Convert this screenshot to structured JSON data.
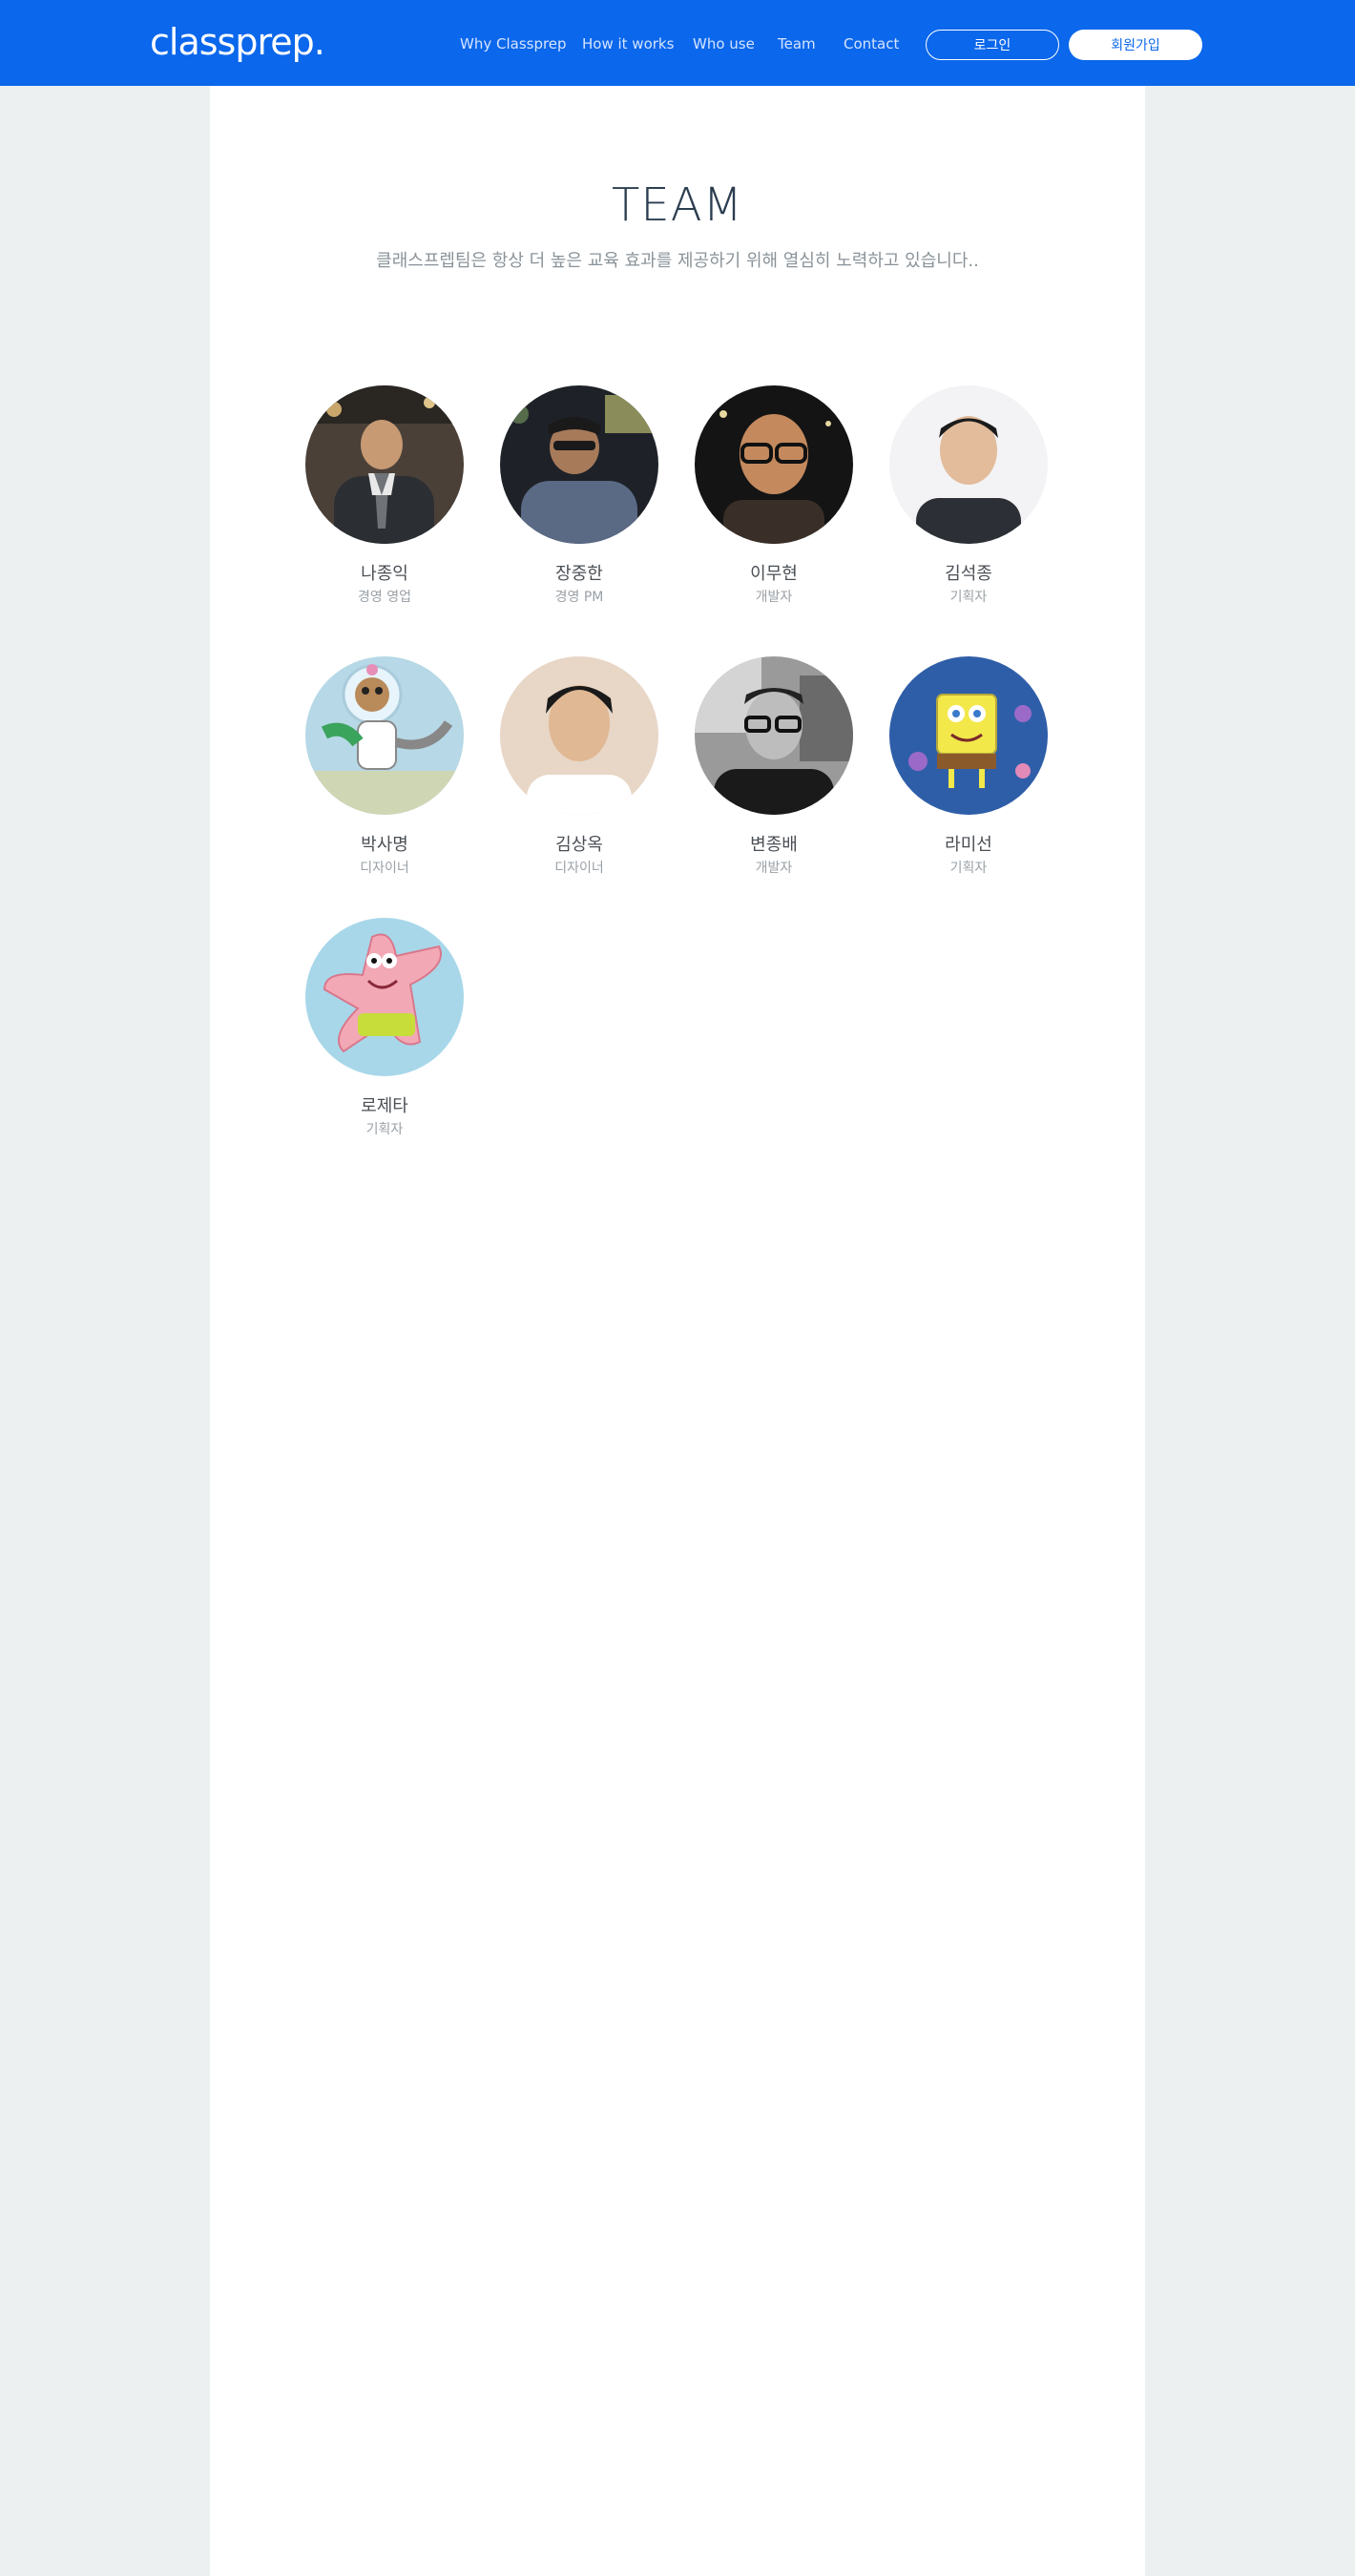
{
  "header": {
    "logo": "classprep.",
    "nav": [
      {
        "label": "Why Classprep"
      },
      {
        "label": "How it works"
      },
      {
        "label": "Who use"
      },
      {
        "label": "Team"
      },
      {
        "label": "Contact"
      }
    ],
    "login_label": "로그인",
    "signup_label": "회원가입",
    "brand_color": "#0b67eb"
  },
  "team": {
    "title": "TEAM",
    "subtitle": "클래스프렙팀은 항상 더 높은 교육 효과를 제공하기 위해 열심히 노력하고 있습니다..",
    "members": [
      {
        "name": "나종익",
        "role": "경영 영업",
        "avatar": "photo-avatar"
      },
      {
        "name": "장중한",
        "role": "경영 PM",
        "avatar": "photo-avatar"
      },
      {
        "name": "이무현",
        "role": "개발자",
        "avatar": "photo-avatar"
      },
      {
        "name": "김석종",
        "role": "기획자",
        "avatar": "photo-avatar"
      },
      {
        "name": "박사명",
        "role": "디자이너",
        "avatar": "cartoon-squirrel-avatar"
      },
      {
        "name": "김상옥",
        "role": "디자이너",
        "avatar": "photo-avatar"
      },
      {
        "name": "변종배",
        "role": "개발자",
        "avatar": "photo-avatar"
      },
      {
        "name": "라미선",
        "role": "기획자",
        "avatar": "cartoon-sponge-avatar"
      },
      {
        "name": "로제타",
        "role": "기획자",
        "avatar": "cartoon-starfish-avatar"
      }
    ]
  }
}
